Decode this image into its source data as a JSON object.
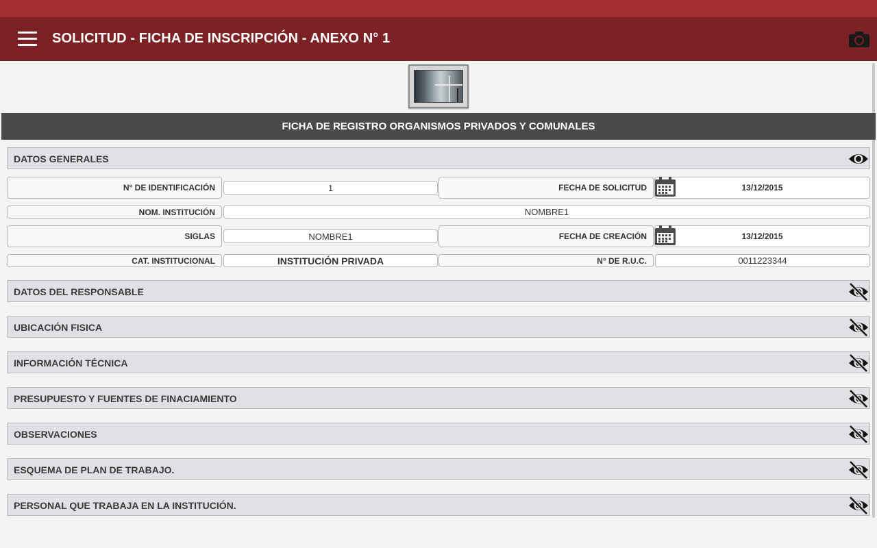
{
  "app": {
    "title": "SOLICITUD - FICHA DE INSCRIPCIÓN - ANEXO N° 1"
  },
  "form": {
    "header": "FICHA DE REGISTRO ORGANISMOS PRIVADOS Y COMUNALES"
  },
  "datos_generales": {
    "title": "DATOS GENERALES",
    "expanded": true,
    "fields": {
      "identificacion_label": "N° DE IDENTIFICACIÓN",
      "identificacion_value": "1",
      "fecha_solicitud_label": "FECHA DE SOLICITUD",
      "fecha_solicitud_value": "13/12/2015",
      "institucion_label": "NOM. INSTITUCIÓN",
      "institucion_value": "NOMBRE1",
      "siglas_label": "SIGLAS",
      "siglas_value": "NOMBRE1",
      "fecha_creacion_label": "FECHA DE CREACIÓN",
      "fecha_creacion_value": "13/12/2015",
      "categoria_label": "CAT. INSTITUCIONAL",
      "categoria_value": "INSTITUCIÓN PRIVADA",
      "ruc_label": "N° DE R.U.C.",
      "ruc_value": "0011223344"
    }
  },
  "sections": [
    {
      "title": "DATOS DEL RESPONSABLE",
      "expanded": false
    },
    {
      "title": "UBICACIÓN FISICA",
      "expanded": false
    },
    {
      "title": "INFORMACIÓN TÉCNICA",
      "expanded": false
    },
    {
      "title": "PRESUPUESTO Y FUENTES DE FINACIAMIENTO",
      "expanded": false
    },
    {
      "title": "OBSERVACIONES",
      "expanded": false
    },
    {
      "title": "ESQUEMA DE PLAN DE TRABAJO.",
      "expanded": false
    },
    {
      "title": "PERSONAL QUE TRABAJA EN LA INSTITUCIÓN.",
      "expanded": false
    }
  ],
  "icons": {
    "menu": "menu-icon",
    "camera": "camera-icon",
    "expanded": "eye-icon",
    "collapsed": "eye-off-icon",
    "calendar": "calendar-icon"
  },
  "colors": {
    "statusbar": "#a32c2f",
    "toolbar": "#7d2224",
    "form_header": "#4a4a4a",
    "section_bg": "#dfe1e4"
  }
}
